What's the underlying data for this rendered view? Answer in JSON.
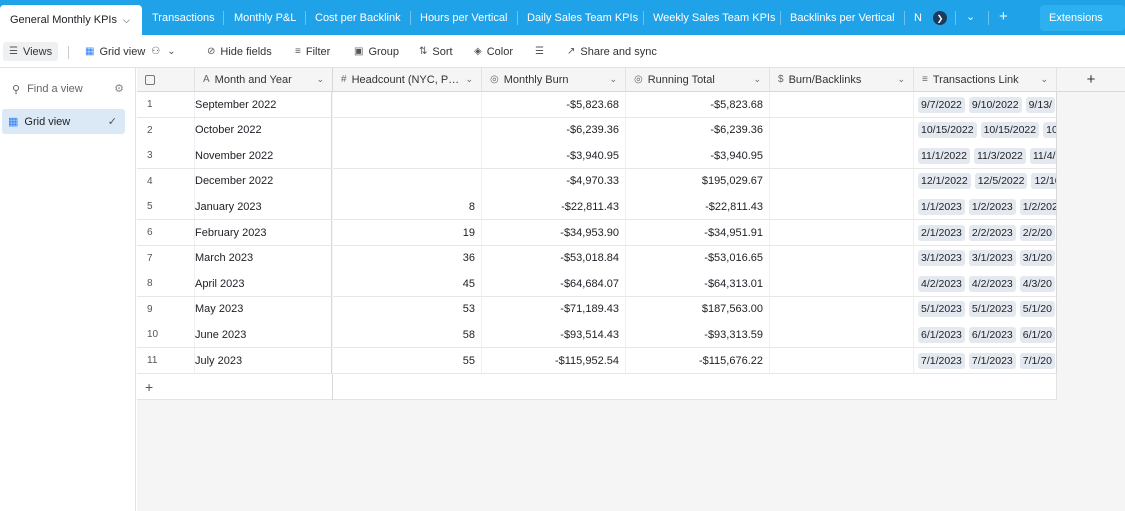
{
  "tabs": {
    "active": "General Monthly KPIs",
    "items": [
      "Transactions",
      "Monthly P&L",
      "Cost per Backlink",
      "Hours per Vertical",
      "Daily Sales Team KPIs",
      "Weekly Sales Team KPIs",
      "Backlinks per Vertical",
      "N"
    ],
    "extensions": "Extensions"
  },
  "toolbar": {
    "views": "Views",
    "grid_view": "Grid view",
    "hide_fields": "Hide fields",
    "filter": "Filter",
    "group": "Group",
    "sort": "Sort",
    "color": "Color",
    "share": "Share and sync"
  },
  "sidebar": {
    "find_placeholder": "Find a view",
    "view_name": "Grid view"
  },
  "columns": {
    "month": "Month and Year",
    "headcount": "Headcount (NYC, P…",
    "burn": "Monthly Burn",
    "running": "Running Total",
    "burn_backlinks": "Burn/Backlinks",
    "transactions": "Transactions Link"
  },
  "rows": [
    {
      "num": "1",
      "month": "September 2022",
      "headcount": "",
      "burn": "-$5,823.68",
      "running": "-$5,823.68",
      "tx": [
        "9/7/2022",
        "9/10/2022",
        "9/13/"
      ]
    },
    {
      "num": "2",
      "month": "October 2022",
      "headcount": "",
      "burn": "-$6,239.36",
      "running": "-$6,239.36",
      "tx": [
        "10/15/2022",
        "10/15/2022",
        "10"
      ]
    },
    {
      "num": "3",
      "month": "November 2022",
      "headcount": "",
      "burn": "-$3,940.95",
      "running": "-$3,940.95",
      "tx": [
        "11/1/2022",
        "11/3/2022",
        "11/4/"
      ]
    },
    {
      "num": "4",
      "month": "December 2022",
      "headcount": "",
      "burn": "-$4,970.33",
      "running": "$195,029.67",
      "tx": [
        "12/1/2022",
        "12/5/2022",
        "12/10"
      ]
    },
    {
      "num": "5",
      "month": "January 2023",
      "headcount": "8",
      "burn": "-$22,811.43",
      "running": "-$22,811.43",
      "tx": [
        "1/1/2023",
        "1/2/2023",
        "1/2/202"
      ]
    },
    {
      "num": "6",
      "month": "February 2023",
      "headcount": "19",
      "burn": "-$34,953.90",
      "running": "-$34,951.91",
      "tx": [
        "2/1/2023",
        "2/2/2023",
        "2/2/20"
      ]
    },
    {
      "num": "7",
      "month": "March 2023",
      "headcount": "36",
      "burn": "-$53,018.84",
      "running": "-$53,016.65",
      "tx": [
        "3/1/2023",
        "3/1/2023",
        "3/1/20"
      ]
    },
    {
      "num": "8",
      "month": "April 2023",
      "headcount": "45",
      "burn": "-$64,684.07",
      "running": "-$64,313.01",
      "tx": [
        "4/2/2023",
        "4/2/2023",
        "4/3/20"
      ]
    },
    {
      "num": "9",
      "month": "May 2023",
      "headcount": "53",
      "burn": "-$71,189.43",
      "running": "$187,563.00",
      "tx": [
        "5/1/2023",
        "5/1/2023",
        "5/1/20"
      ]
    },
    {
      "num": "10",
      "month": "June 2023",
      "headcount": "58",
      "burn": "-$93,514.43",
      "running": "-$93,313.59",
      "tx": [
        "6/1/2023",
        "6/1/2023",
        "6/1/20"
      ]
    },
    {
      "num": "11",
      "month": "July 2023",
      "headcount": "55",
      "burn": "-$115,952.54",
      "running": "-$115,676.22",
      "tx": [
        "7/1/2023",
        "7/1/2023",
        "7/1/20"
      ]
    }
  ],
  "colors": {
    "tabbar": "#1fa2e8",
    "accent": "#2d7ff9",
    "selected_view": "#dbe9f6"
  }
}
